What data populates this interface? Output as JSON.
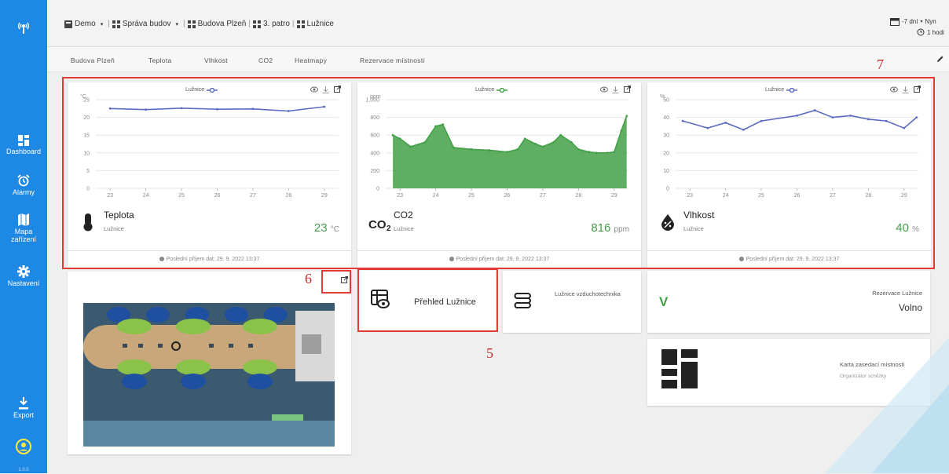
{
  "sidebar": {
    "items": [
      {
        "label": "Dashboard"
      },
      {
        "label": "Alarmy"
      },
      {
        "label": "Mapa zařízení"
      },
      {
        "label": "Nastavení"
      },
      {
        "label": "Export"
      }
    ],
    "version": "1.0.0"
  },
  "breadcrumb": {
    "items": [
      "Demo",
      "Správa budov",
      "Budova Plzeň",
      "3. patro",
      "Lužnice"
    ]
  },
  "header": {
    "period": "-7 dní",
    "period_short": "Nyn",
    "refresh": "1 hodi"
  },
  "tabs": [
    "Budova Plzeň",
    "Teplota",
    "Vlhkost",
    "CO2",
    "Heatmapy",
    "Rezervace místností"
  ],
  "colors": {
    "sidebar": "#1e88e5",
    "green": "#43a047",
    "blue_series": "#5c6bc0",
    "annotation": "#e53935"
  },
  "charts": [
    {
      "title": "Teplota",
      "subtitle": "Lužnice",
      "value": "23",
      "unit": "°C",
      "legend": "Lužnice",
      "ylabel": "°C",
      "footer": "Poslední příjem dat: 29. 9. 2022 13:37",
      "chart_data": {
        "type": "line",
        "x": [
          23,
          24,
          25,
          26,
          27,
          28,
          29
        ],
        "series": [
          {
            "name": "Lužnice",
            "values": [
              22.5,
              22.2,
              22.6,
              22.3,
              22.4,
              21.8,
              23
            ]
          }
        ],
        "yticks": [
          "0",
          "5",
          "10",
          "15",
          "20",
          "25"
        ],
        "xticks": [
          "23",
          "24",
          "25",
          "26",
          "27",
          "28",
          "29"
        ],
        "ylim": [
          0,
          25
        ]
      }
    },
    {
      "title": "CO2",
      "subtitle": "Lužnice",
      "value": "816",
      "unit": "ppm",
      "legend": "Lužnice",
      "ylabel": "ppm",
      "footer": "Poslední příjem dat: 29. 9. 2022 13:37",
      "chart_data": {
        "type": "area",
        "x": [
          22.8,
          23,
          23.3,
          23.7,
          24,
          24.2,
          24.5,
          25,
          25.5,
          26,
          26.3,
          26.5,
          26.8,
          27,
          27.3,
          27.5,
          27.8,
          28,
          28.3,
          28.5,
          28.8,
          29,
          29.2,
          29.35
        ],
        "series": [
          {
            "name": "Lužnice",
            "values": [
              600,
              560,
              470,
              520,
              700,
              720,
              460,
              440,
              430,
              410,
              440,
              560,
              500,
              470,
              520,
              600,
              520,
              440,
              410,
              400,
              400,
              410,
              650,
              816
            ]
          }
        ],
        "yticks": [
          "0",
          "200",
          "400",
          "600",
          "800",
          "1,000"
        ],
        "xticks": [
          "23",
          "24",
          "25",
          "26",
          "27",
          "28",
          "29"
        ],
        "ylim": [
          0,
          1000
        ]
      }
    },
    {
      "title": "Vlhkost",
      "subtitle": "Lužnice",
      "value": "40",
      "unit": "%",
      "legend": "Lužnice",
      "ylabel": "%",
      "footer": "Poslední příjem dat: 29. 9. 2022 13:37",
      "chart_data": {
        "type": "line",
        "x": [
          22.8,
          23.5,
          24,
          24.5,
          25,
          26,
          26.5,
          27,
          27.5,
          28,
          28.5,
          29,
          29.35
        ],
        "series": [
          {
            "name": "Lužnice",
            "values": [
              38,
              34,
              37,
              33,
              38,
              41,
              44,
              40,
              41,
              39,
              38,
              34,
              40
            ]
          }
        ],
        "yticks": [
          "0",
          "10",
          "20",
          "30",
          "40",
          "50"
        ],
        "xticks": [
          "23",
          "24",
          "25",
          "26",
          "27",
          "28",
          "29"
        ],
        "ylim": [
          0,
          50
        ]
      }
    }
  ],
  "tiles": {
    "prehled": "Přehled Lužnice",
    "vzduchotechnika": "Lužnice vzduchotechnika",
    "rezervace_title": "Rezervace Lužnice",
    "rezervace_state": "Volno",
    "karta_title": "Karta zasedací místnosti",
    "karta_sub": "Organizátor schůzky"
  },
  "annotations": [
    "7",
    "6",
    "5"
  ]
}
